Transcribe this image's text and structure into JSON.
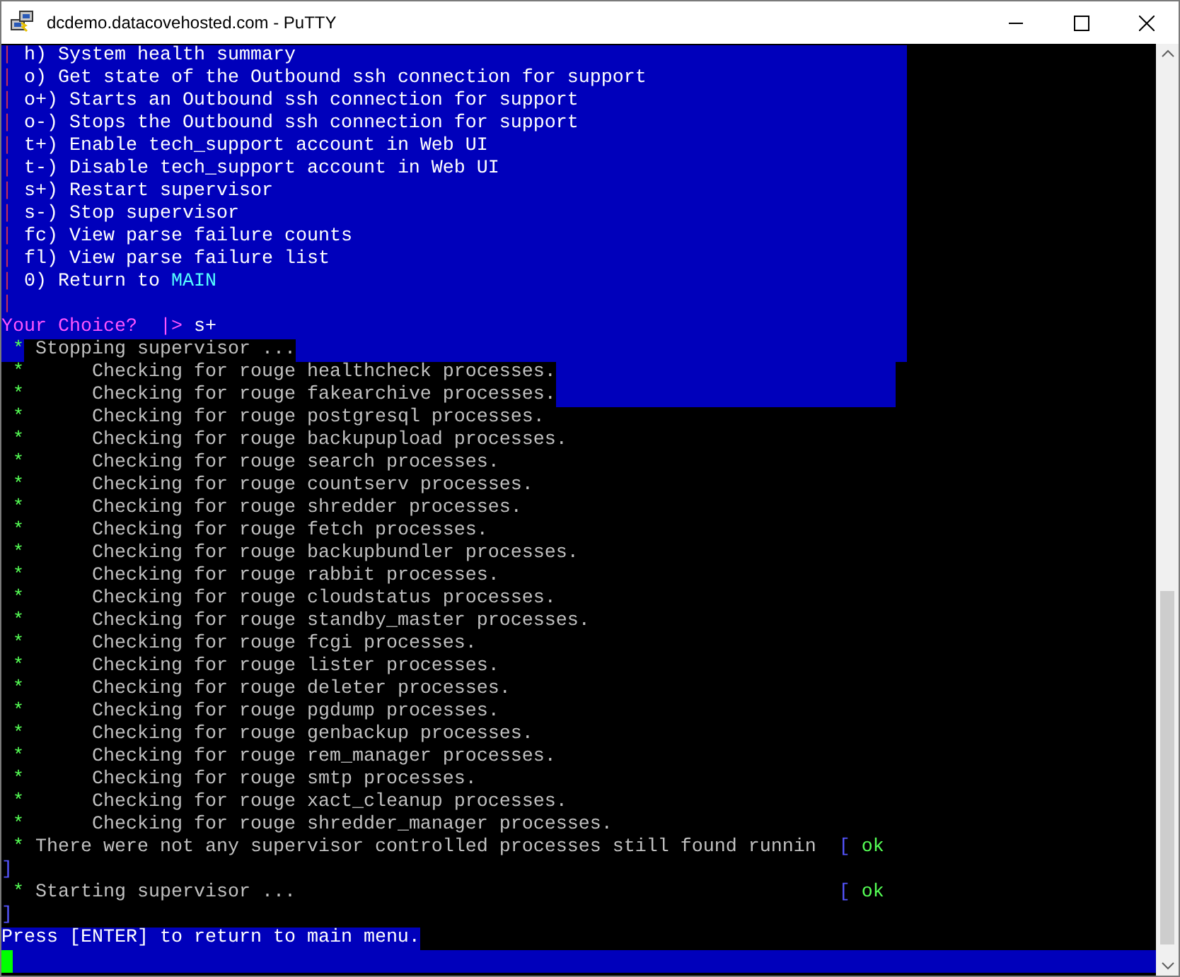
{
  "window": {
    "title": "dcdemo.datacovehosted.com - PuTTY"
  },
  "lines": [
    {
      "kind": "menu",
      "segments": [
        {
          "kind": "pipe",
          "text": "|"
        },
        {
          "kind": "bright",
          "text": " h) System health summary"
        }
      ]
    },
    {
      "kind": "menu",
      "segments": [
        {
          "kind": "pipe",
          "text": "|"
        },
        {
          "kind": "bright",
          "text": " o) Get state of the Outbound ssh connection for support"
        }
      ]
    },
    {
      "kind": "menu",
      "segments": [
        {
          "kind": "pipe",
          "text": "|"
        },
        {
          "kind": "bright",
          "text": " o+) Starts an Outbound ssh connection for support"
        }
      ]
    },
    {
      "kind": "menu",
      "segments": [
        {
          "kind": "pipe",
          "text": "|"
        },
        {
          "kind": "bright",
          "text": " o-) Stops the Outbound ssh connection for support"
        }
      ]
    },
    {
      "kind": "menu",
      "segments": [
        {
          "kind": "pipe",
          "text": "|"
        },
        {
          "kind": "bright",
          "text": " t+) Enable tech_support account in Web UI"
        }
      ]
    },
    {
      "kind": "menu",
      "segments": [
        {
          "kind": "pipe",
          "text": "|"
        },
        {
          "kind": "bright",
          "text": " t-) Disable tech_support account in Web UI"
        }
      ]
    },
    {
      "kind": "menu",
      "segments": [
        {
          "kind": "pipe",
          "text": "|"
        },
        {
          "kind": "bright",
          "text": " s+) Restart supervisor"
        }
      ]
    },
    {
      "kind": "menu",
      "segments": [
        {
          "kind": "pipe",
          "text": "|"
        },
        {
          "kind": "bright",
          "text": " s-) Stop supervisor"
        }
      ]
    },
    {
      "kind": "menu",
      "segments": [
        {
          "kind": "pipe",
          "text": "|"
        },
        {
          "kind": "bright",
          "text": " fc) View parse failure counts"
        }
      ]
    },
    {
      "kind": "menu",
      "segments": [
        {
          "kind": "pipe",
          "text": "|"
        },
        {
          "kind": "bright",
          "text": " fl) View parse failure list"
        }
      ]
    },
    {
      "kind": "menu",
      "segments": [
        {
          "kind": "pipe",
          "text": "|"
        },
        {
          "kind": "bright",
          "text": " 0) Return to "
        },
        {
          "kind": "main",
          "text": "MAIN"
        }
      ]
    },
    {
      "kind": "menu",
      "segments": [
        {
          "kind": "pipe",
          "text": "|"
        }
      ]
    },
    {
      "kind": "menu",
      "segments": [
        {
          "kind": "prompt",
          "text": "Your Choice?  |>"
        },
        {
          "kind": "input",
          "text": " s+"
        }
      ]
    },
    {
      "kind": "menu",
      "segments": [
        {
          "kind": "star",
          "text": " *"
        },
        {
          "kind": "boxed",
          "text": " Stopping supervisor ..."
        }
      ]
    },
    {
      "kind": "trail",
      "segments": [
        {
          "kind": "boxed-star",
          "text": " *"
        },
        {
          "kind": "boxed",
          "text": "      Checking for rouge healthcheck processes."
        }
      ]
    },
    {
      "kind": "trail",
      "segments": [
        {
          "kind": "boxed-star",
          "text": " *"
        },
        {
          "kind": "boxed",
          "text": "      Checking for rouge fakearchive processes."
        }
      ]
    },
    {
      "kind": "plain",
      "segments": [
        {
          "kind": "star",
          "text": " *"
        },
        {
          "kind": "dim",
          "text": "      Checking for rouge postgresql processes."
        }
      ]
    },
    {
      "kind": "plain",
      "segments": [
        {
          "kind": "star",
          "text": " *"
        },
        {
          "kind": "dim",
          "text": "      Checking for rouge backupupload processes."
        }
      ]
    },
    {
      "kind": "plain",
      "segments": [
        {
          "kind": "star",
          "text": " *"
        },
        {
          "kind": "dim",
          "text": "      Checking for rouge search processes."
        }
      ]
    },
    {
      "kind": "plain",
      "segments": [
        {
          "kind": "star",
          "text": " *"
        },
        {
          "kind": "dim",
          "text": "      Checking for rouge countserv processes."
        }
      ]
    },
    {
      "kind": "plain",
      "segments": [
        {
          "kind": "star",
          "text": " *"
        },
        {
          "kind": "dim",
          "text": "      Checking for rouge shredder processes."
        }
      ]
    },
    {
      "kind": "plain",
      "segments": [
        {
          "kind": "star",
          "text": " *"
        },
        {
          "kind": "dim",
          "text": "      Checking for rouge fetch processes."
        }
      ]
    },
    {
      "kind": "plain",
      "segments": [
        {
          "kind": "star",
          "text": " *"
        },
        {
          "kind": "dim",
          "text": "      Checking for rouge backupbundler processes."
        }
      ]
    },
    {
      "kind": "plain",
      "segments": [
        {
          "kind": "star",
          "text": " *"
        },
        {
          "kind": "dim",
          "text": "      Checking for rouge rabbit processes."
        }
      ]
    },
    {
      "kind": "plain",
      "segments": [
        {
          "kind": "star",
          "text": " *"
        },
        {
          "kind": "dim",
          "text": "      Checking for rouge cloudstatus processes."
        }
      ]
    },
    {
      "kind": "plain",
      "segments": [
        {
          "kind": "star",
          "text": " *"
        },
        {
          "kind": "dim",
          "text": "      Checking for rouge standby_master processes."
        }
      ]
    },
    {
      "kind": "plain",
      "segments": [
        {
          "kind": "star",
          "text": " *"
        },
        {
          "kind": "dim",
          "text": "      Checking for rouge fcgi processes."
        }
      ]
    },
    {
      "kind": "plain",
      "segments": [
        {
          "kind": "star",
          "text": " *"
        },
        {
          "kind": "dim",
          "text": "      Checking for rouge lister processes."
        }
      ]
    },
    {
      "kind": "plain",
      "segments": [
        {
          "kind": "star",
          "text": " *"
        },
        {
          "kind": "dim",
          "text": "      Checking for rouge deleter processes."
        }
      ]
    },
    {
      "kind": "plain",
      "segments": [
        {
          "kind": "star",
          "text": " *"
        },
        {
          "kind": "dim",
          "text": "      Checking for rouge pgdump processes."
        }
      ]
    },
    {
      "kind": "plain",
      "segments": [
        {
          "kind": "star",
          "text": " *"
        },
        {
          "kind": "dim",
          "text": "      Checking for rouge genbackup processes."
        }
      ]
    },
    {
      "kind": "plain",
      "segments": [
        {
          "kind": "star",
          "text": " *"
        },
        {
          "kind": "dim",
          "text": "      Checking for rouge rem_manager processes."
        }
      ]
    },
    {
      "kind": "plain",
      "segments": [
        {
          "kind": "star",
          "text": " *"
        },
        {
          "kind": "dim",
          "text": "      Checking for rouge smtp processes."
        }
      ]
    },
    {
      "kind": "plain",
      "segments": [
        {
          "kind": "star",
          "text": " *"
        },
        {
          "kind": "dim",
          "text": "      Checking for rouge xact_cleanup processes."
        }
      ]
    },
    {
      "kind": "plain",
      "segments": [
        {
          "kind": "star",
          "text": " *"
        },
        {
          "kind": "dim",
          "text": "      Checking for rouge shredder_manager processes."
        }
      ]
    },
    {
      "kind": "plain",
      "segments": [
        {
          "kind": "star",
          "text": " *"
        },
        {
          "kind": "dim",
          "text": " There were not any supervisor controlled processes still found runnin  "
        },
        {
          "kind": "bracket",
          "text": "["
        },
        {
          "kind": "ok",
          "text": " ok"
        }
      ]
    },
    {
      "kind": "plain",
      "segments": [
        {
          "kind": "bracket",
          "text": "]"
        }
      ]
    },
    {
      "kind": "plain",
      "segments": [
        {
          "kind": "star",
          "text": " *"
        },
        {
          "kind": "dim",
          "text": " Starting supervisor ...                                                "
        },
        {
          "kind": "bracket",
          "text": "["
        },
        {
          "kind": "ok",
          "text": " ok"
        }
      ]
    },
    {
      "kind": "plain",
      "segments": [
        {
          "kind": "bracket",
          "text": "]"
        }
      ]
    },
    {
      "kind": "plain",
      "segments": [
        {
          "kind": "press",
          "text": "Press [ENTER] to return to main menu."
        }
      ]
    },
    {
      "kind": "full",
      "cursor": true
    }
  ]
}
